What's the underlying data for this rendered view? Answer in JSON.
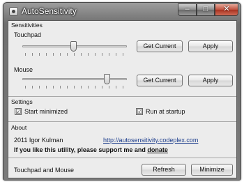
{
  "window": {
    "title": "AutoSensitivity",
    "caption": {
      "minimize": "–",
      "maximize": "□",
      "close": "✕"
    }
  },
  "sensitivities": {
    "heading": "Sensitivities",
    "touchpad": {
      "label": "Touchpad",
      "level_fraction": 0.49,
      "get_current_label": "Get Current",
      "apply_label": "Apply"
    },
    "mouse": {
      "label": "Mouse",
      "level_fraction": 0.83,
      "get_current_label": "Get Current",
      "apply_label": "Apply"
    }
  },
  "settings": {
    "heading": "Settings",
    "start_minimized": {
      "label": "Start minimized",
      "checked": true
    },
    "run_at_startup": {
      "label": "Run at startup",
      "checked": true
    },
    "check_glyph": "☑"
  },
  "about": {
    "heading": "About",
    "copyright": "2011 Igor Kulman",
    "link": "http://autosensitivity.codeplex.com",
    "support_text": "If you like this utility, please support me and",
    "donate_label": "donate"
  },
  "footer": {
    "status": "Touchpad and Mouse",
    "refresh_label": "Refresh",
    "minimize_label": "Minimize"
  }
}
